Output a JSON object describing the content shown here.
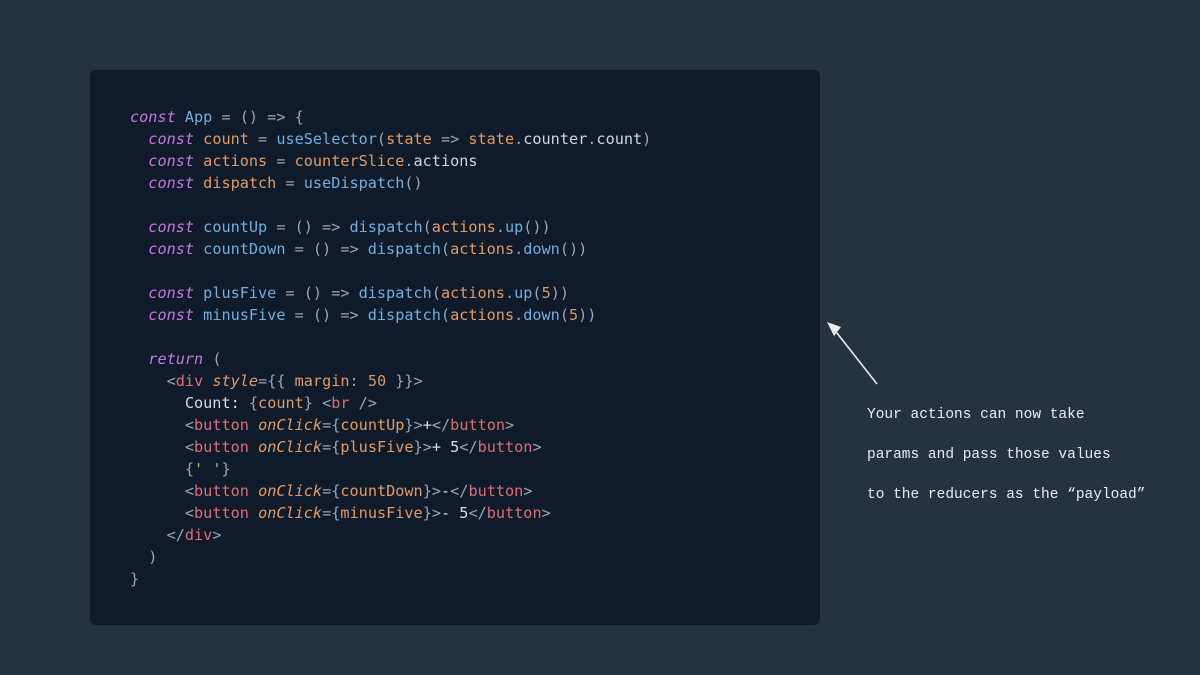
{
  "colors": {
    "bg": "#253240",
    "panel": "#0f1a2a",
    "text": "#d7dee8",
    "keyword": "#c678dd",
    "func": "#6fb0e0",
    "var": "#e49a67",
    "tag": "#e06c75",
    "number": "#d19a66",
    "string": "#98c379",
    "punc": "#9aa5b5"
  },
  "annotation": {
    "line1": "Your actions can now take",
    "line2": "params and pass those values",
    "line3": "to the reducers as the “payload”"
  },
  "code": {
    "l01_const": "const",
    "l01_App": "App",
    "l01_rest": " = () => {",
    "l02_const": "const",
    "l02_count": "count",
    "l02_eq": " = ",
    "l02_useSel": "useSelector",
    "l02_op": "(",
    "l02_state1": "state",
    "l02_arrow": " => ",
    "l02_state2": "state",
    "l02_dot1": ".",
    "l02_counter": "counter",
    "l02_dot2": ".",
    "l02_countp": "count",
    "l02_cp": ")",
    "l03_const": "const",
    "l03_actions": "actions",
    "l03_eq": " = ",
    "l03_cs": "counterSlice",
    "l03_dot": ".",
    "l03_ac": "actions",
    "l04_const": "const",
    "l04_dispatch": "dispatch",
    "l04_eq": " = ",
    "l04_useD": "useDispatch",
    "l04_p": "()",
    "l06_const": "const",
    "l06_cu": "countUp",
    "l06_mid": " = () => ",
    "l06_disp": "dispatch",
    "l06_op": "(",
    "l06_ac": "actions",
    "l06_dot": ".",
    "l06_up": "up",
    "l06_pp": "())",
    "l07_const": "const",
    "l07_cd": "countDown",
    "l07_mid": " = () => ",
    "l07_disp": "dispatch",
    "l07_op": "(",
    "l07_ac": "actions",
    "l07_dot": ".",
    "l07_dn": "down",
    "l07_pp": "())",
    "l09_const": "const",
    "l09_pf": "plusFive",
    "l09_mid": " = () => ",
    "l09_disp": "dispatch",
    "l09_op": "(",
    "l09_ac": "actions",
    "l09_dot": ".",
    "l09_up": "up",
    "l09_o2": "(",
    "l09_5": "5",
    "l09_cp": "))",
    "l10_const": "const",
    "l10_mf": "minusFive",
    "l10_mid": " = () => ",
    "l10_disp": "dispatch",
    "l10_op": "(",
    "l10_ac": "actions",
    "l10_dot": ".",
    "l10_dn": "down",
    "l10_o2": "(",
    "l10_5": "5",
    "l10_cp": "))",
    "l12_return": "return",
    "l12_op": " (",
    "l13_a": "<",
    "l13_div": "div",
    "l13_sp": " ",
    "l13_style": "style",
    "l13_eq": "=",
    "l13_bo": "{{ ",
    "l13_m": "margin",
    "l13_c": ": ",
    "l13_50": "50",
    "l13_bc": " }}",
    "l13_z": ">",
    "l14_txt": "Count: ",
    "l14_bo": "{",
    "l14_cv": "count",
    "l14_bc": "}",
    "l14_sp": " ",
    "l14_a": "<",
    "l14_br": "br",
    "l14_sl": " />",
    "l15_a": "<",
    "l15_btn": "button",
    "l15_sp": " ",
    "l15_oc": "onClick",
    "l15_eq": "=",
    "l15_bo": "{",
    "l15_h": "countUp",
    "l15_bc": "}",
    "l15_z": ">",
    "l15_txt": "+",
    "l15_a2": "</",
    "l15_btn2": "button",
    "l15_z2": ">",
    "l16_a": "<",
    "l16_btn": "button",
    "l16_sp": " ",
    "l16_oc": "onClick",
    "l16_eq": "=",
    "l16_bo": "{",
    "l16_h": "plusFive",
    "l16_bc": "}",
    "l16_z": ">",
    "l16_txt": "+ 5",
    "l16_a2": "</",
    "l16_btn2": "button",
    "l16_z2": ">",
    "l17_bo": "{",
    "l17_str": "' '",
    "l17_bc": "}",
    "l18_a": "<",
    "l18_btn": "button",
    "l18_sp": " ",
    "l18_oc": "onClick",
    "l18_eq": "=",
    "l18_bo": "{",
    "l18_h": "countDown",
    "l18_bc": "}",
    "l18_z": ">",
    "l18_txt": "-",
    "l18_a2": "</",
    "l18_btn2": "button",
    "l18_z2": ">",
    "l19_a": "<",
    "l19_btn": "button",
    "l19_sp": " ",
    "l19_oc": "onClick",
    "l19_eq": "=",
    "l19_bo": "{",
    "l19_h": "minusFive",
    "l19_bc": "}",
    "l19_z": ">",
    "l19_txt": "- 5",
    "l19_a2": "</",
    "l19_btn2": "button",
    "l19_z2": ">",
    "l20_a": "</",
    "l20_div": "div",
    "l20_z": ">",
    "l21": ")",
    "l22": "}"
  }
}
